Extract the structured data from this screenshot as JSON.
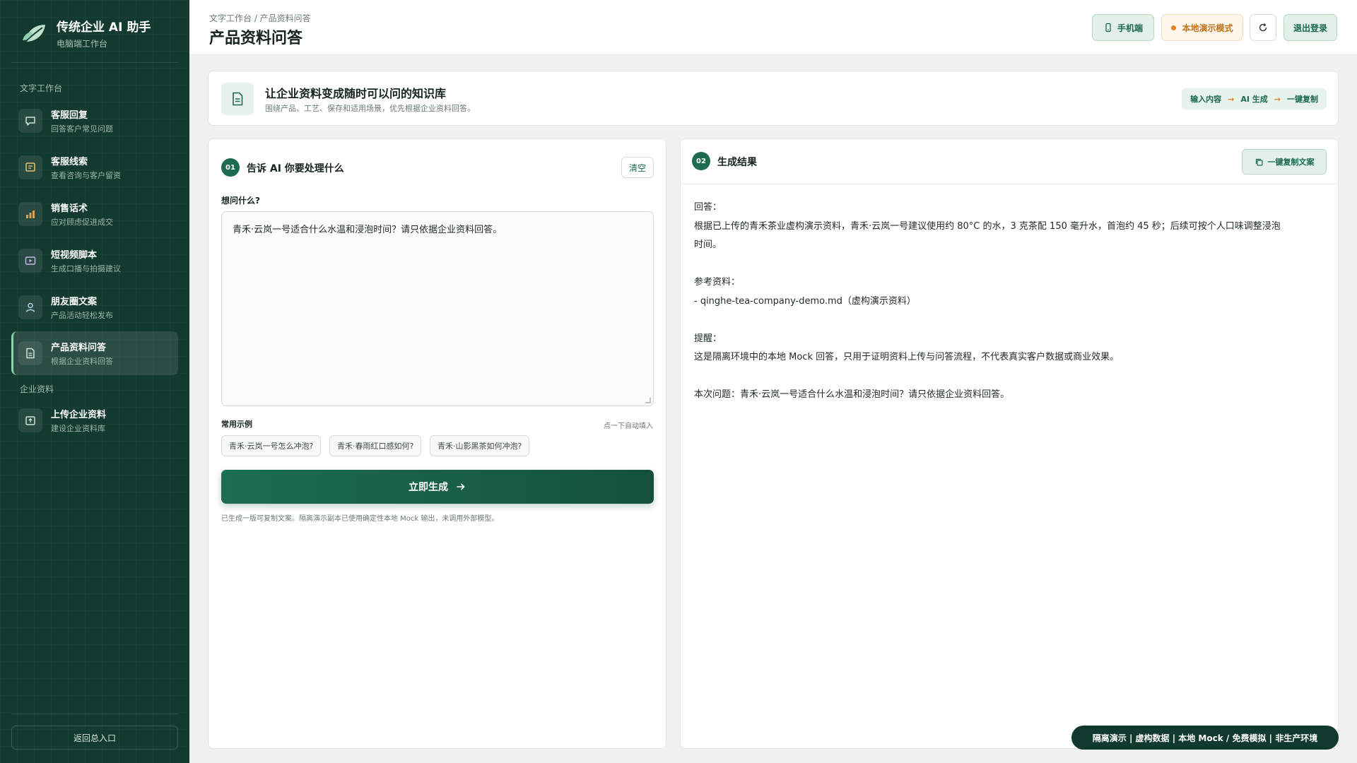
{
  "brand": {
    "title": "传统企业 AI 助手",
    "subtitle": "电脑端工作台"
  },
  "sidebar": {
    "section_text": "文字工作台",
    "items": [
      {
        "label": "客服回复",
        "desc": "回答客户常见问题",
        "icon": "chat-bubble-icon"
      },
      {
        "label": "客服线索",
        "desc": "查看咨询与客户留资",
        "icon": "message-list-icon"
      },
      {
        "label": "销售话术",
        "desc": "应对顾虑促进成交",
        "icon": "bar-chart-icon"
      },
      {
        "label": "短视频脚本",
        "desc": "生成口播与拍摄建议",
        "icon": "video-play-icon"
      },
      {
        "label": "朋友圈文案",
        "desc": "产品活动轻松发布",
        "icon": "user-icon"
      },
      {
        "label": "产品资料问答",
        "desc": "根据企业资料回答",
        "icon": "document-icon",
        "active": true
      }
    ],
    "section_data": "企业资料",
    "data_items": [
      {
        "label": "上传企业资料",
        "desc": "建设企业资料库",
        "icon": "upload-icon"
      }
    ],
    "back_label": "返回总入口"
  },
  "header": {
    "breadcrumb": "文字工作台 / 产品资料问答",
    "title": "产品资料问答",
    "mobile_label": "手机端",
    "demo_label": "本地演示模式",
    "logout_label": "退出登录"
  },
  "banner": {
    "title": "让企业资料变成随时可以问的知识库",
    "subtitle": "围绕产品、工艺、保存和适用场景，优先根据企业资料回答。",
    "flow": [
      "输入内容",
      "AI 生成",
      "一键复制"
    ],
    "flow_arrow": "→"
  },
  "input_panel": {
    "step": "01",
    "title": "告诉 AI 你要处理什么",
    "clear_label": "清空",
    "field_label": "想问什么?",
    "question": "青禾·云岚一号适合什么水温和浸泡时间？请只依据企业资料回答。",
    "examples_label": "常用示例",
    "examples_hint": "点一下自动填入",
    "examples": [
      "青禾·云岚一号怎么冲泡?",
      "青禾·春雨红口感如何?",
      "青禾·山影黑茶如何冲泡?"
    ],
    "generate_label": "立即生成",
    "status": "已生成一版可复制文案。隔离演示副本已使用确定性本地 Mock 输出，未调用外部模型。"
  },
  "result_panel": {
    "step": "02",
    "title": "生成结果",
    "copy_label": "一键复制文案",
    "answer_heading": "回答：",
    "answer_line1": "根据已上传的青禾茶业虚构演示资料，青禾·云岚一号建议使用约 80°C 的水，3 克茶配 150 毫升水，首泡约 45 秒；后续可按个人口味调整浸泡",
    "answer_line2": "时间。",
    "ref_heading": "参考资料：",
    "ref_item": "- qinghe-tea-company-demo.md（虚构演示资料）",
    "note_heading": "提醒：",
    "note_text": "这是隔离环境中的本地 Mock 回答，只用于证明资料上传与问答流程，不代表真实客户数据或商业效果。",
    "question_line": "本次问题：青禾·云岚一号适合什么水温和浸泡时间？请只依据企业资料回答。"
  },
  "footer_badge": "隔离演示 | 虚构数据 | 本地 Mock / 免费模拟 | 非生产环境",
  "colors": {
    "sidebar_bg": "#123a2f",
    "accent": "#1d6a4c",
    "warning": "#e3821e"
  }
}
